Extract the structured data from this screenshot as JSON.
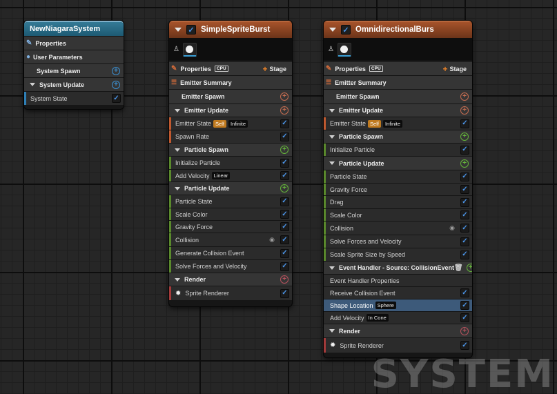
{
  "system_node": {
    "title": "NewNiagaraSystem",
    "properties_label": "Properties",
    "user_parameters_label": "User Parameters",
    "system_spawn_label": "System Spawn",
    "system_update_label": "System Update",
    "system_state_label": "System State"
  },
  "emitter1": {
    "title": "SimpleSpriteBurst",
    "properties_label": "Properties",
    "cpu_badge": "CPU",
    "stage_label": "Stage",
    "summary_label": "Emitter Summary",
    "emitter_spawn": "Emitter Spawn",
    "emitter_update": "Emitter Update",
    "emitter_state": "Emitter State",
    "emitter_state_tag1": "Self",
    "emitter_state_tag2": "Infinite",
    "spawn_rate": "Spawn Rate",
    "particle_spawn": "Particle Spawn",
    "initialize_particle": "Initialize Particle",
    "add_velocity": "Add Velocity",
    "add_velocity_tag": "Linear",
    "particle_update": "Particle Update",
    "particle_state": "Particle State",
    "scale_color": "Scale Color",
    "gravity_force": "Gravity Force",
    "collision": "Collision",
    "generate_collision_event": "Generate Collision Event",
    "solve_forces": "Solve Forces and Velocity",
    "render": "Render",
    "sprite_renderer": "Sprite Renderer"
  },
  "emitter2": {
    "title": "OmnidirectionalBurs",
    "properties_label": "Properties",
    "cpu_badge": "CPU",
    "stage_label": "Stage",
    "summary_label": "Emitter Summary",
    "emitter_spawn": "Emitter Spawn",
    "emitter_update": "Emitter Update",
    "emitter_state": "Emitter State",
    "emitter_state_tag1": "Self",
    "emitter_state_tag2": "Infinite",
    "particle_spawn": "Particle Spawn",
    "initialize_particle": "Initialize Particle",
    "particle_update": "Particle Update",
    "particle_state": "Particle State",
    "gravity_force": "Gravity Force",
    "drag": "Drag",
    "scale_color": "Scale Color",
    "collision": "Collision",
    "solve_forces": "Solve Forces and Velocity",
    "scale_sprite_size": "Scale Sprite Size by Speed",
    "event_handler": "Event Handler - Source: CollisionEvent",
    "event_handler_properties": "Event Handler Properties",
    "receive_collision_event": "Receive Collision Event",
    "shape_location": "Shape Location",
    "shape_location_tag": "Sphere",
    "add_velocity": "Add Velocity",
    "add_velocity_tag": "In Cone",
    "render": "Render",
    "sprite_renderer": "Sprite Renderer"
  },
  "watermark": "SYSTEM",
  "colors": {
    "system_header": "#2a6d88",
    "emitter_header": "#8c4422",
    "check_blue": "#4b94e8",
    "spawn_green": "#64b43a",
    "update_orange": "#c46c50",
    "selection": "#3d5a7a"
  }
}
